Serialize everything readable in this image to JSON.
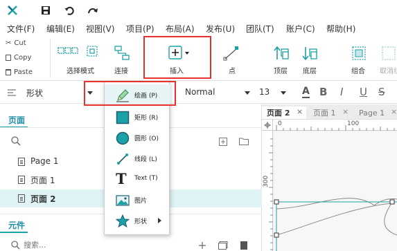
{
  "titlebar": {
    "logo": "x-logo-icon"
  },
  "menu": [
    "文件(F)",
    "编辑(E)",
    "视图(V)",
    "项目(P)",
    "布局(A)",
    "发布(U)",
    "团队(T)",
    "账户(C)",
    "帮助(H)"
  ],
  "clipboard": {
    "cut": "Cut",
    "copy": "Copy",
    "paste": "Paste"
  },
  "ribbon": {
    "select_mode": "选择模式",
    "connect": "连接",
    "insert": "插入",
    "point": "点",
    "top": "顶层",
    "bottom": "底层",
    "group": "组合",
    "ungroup": "取消组合"
  },
  "formatbar": {
    "shape_label": "形状",
    "style_value": "Normal",
    "size_value": "13",
    "bold": "B",
    "italic": "I",
    "underline": "U",
    "strike": "S",
    "font_color_letter": "A"
  },
  "left_panel": {
    "pages_title": "页面",
    "pages": [
      "Page 1",
      "页面 1",
      "页面 2"
    ],
    "widgets_title": "元件",
    "search_placeholder": "搜索..."
  },
  "canvas": {
    "tabs": [
      "页面 2",
      "页面 1",
      "Page 1"
    ],
    "ruler_h": [
      "0",
      "100"
    ],
    "ruler_v": [
      "300"
    ]
  },
  "dropdown": {
    "items": [
      "绘画 (P)",
      "矩形 (R)",
      "圆形 (O)",
      "线段 (L)",
      "Text (T)",
      "图片",
      "形状"
    ]
  },
  "colors": {
    "accent": "#1ca1a6",
    "highlight": "#e8302c",
    "selected_row": "#e0f3f5"
  }
}
